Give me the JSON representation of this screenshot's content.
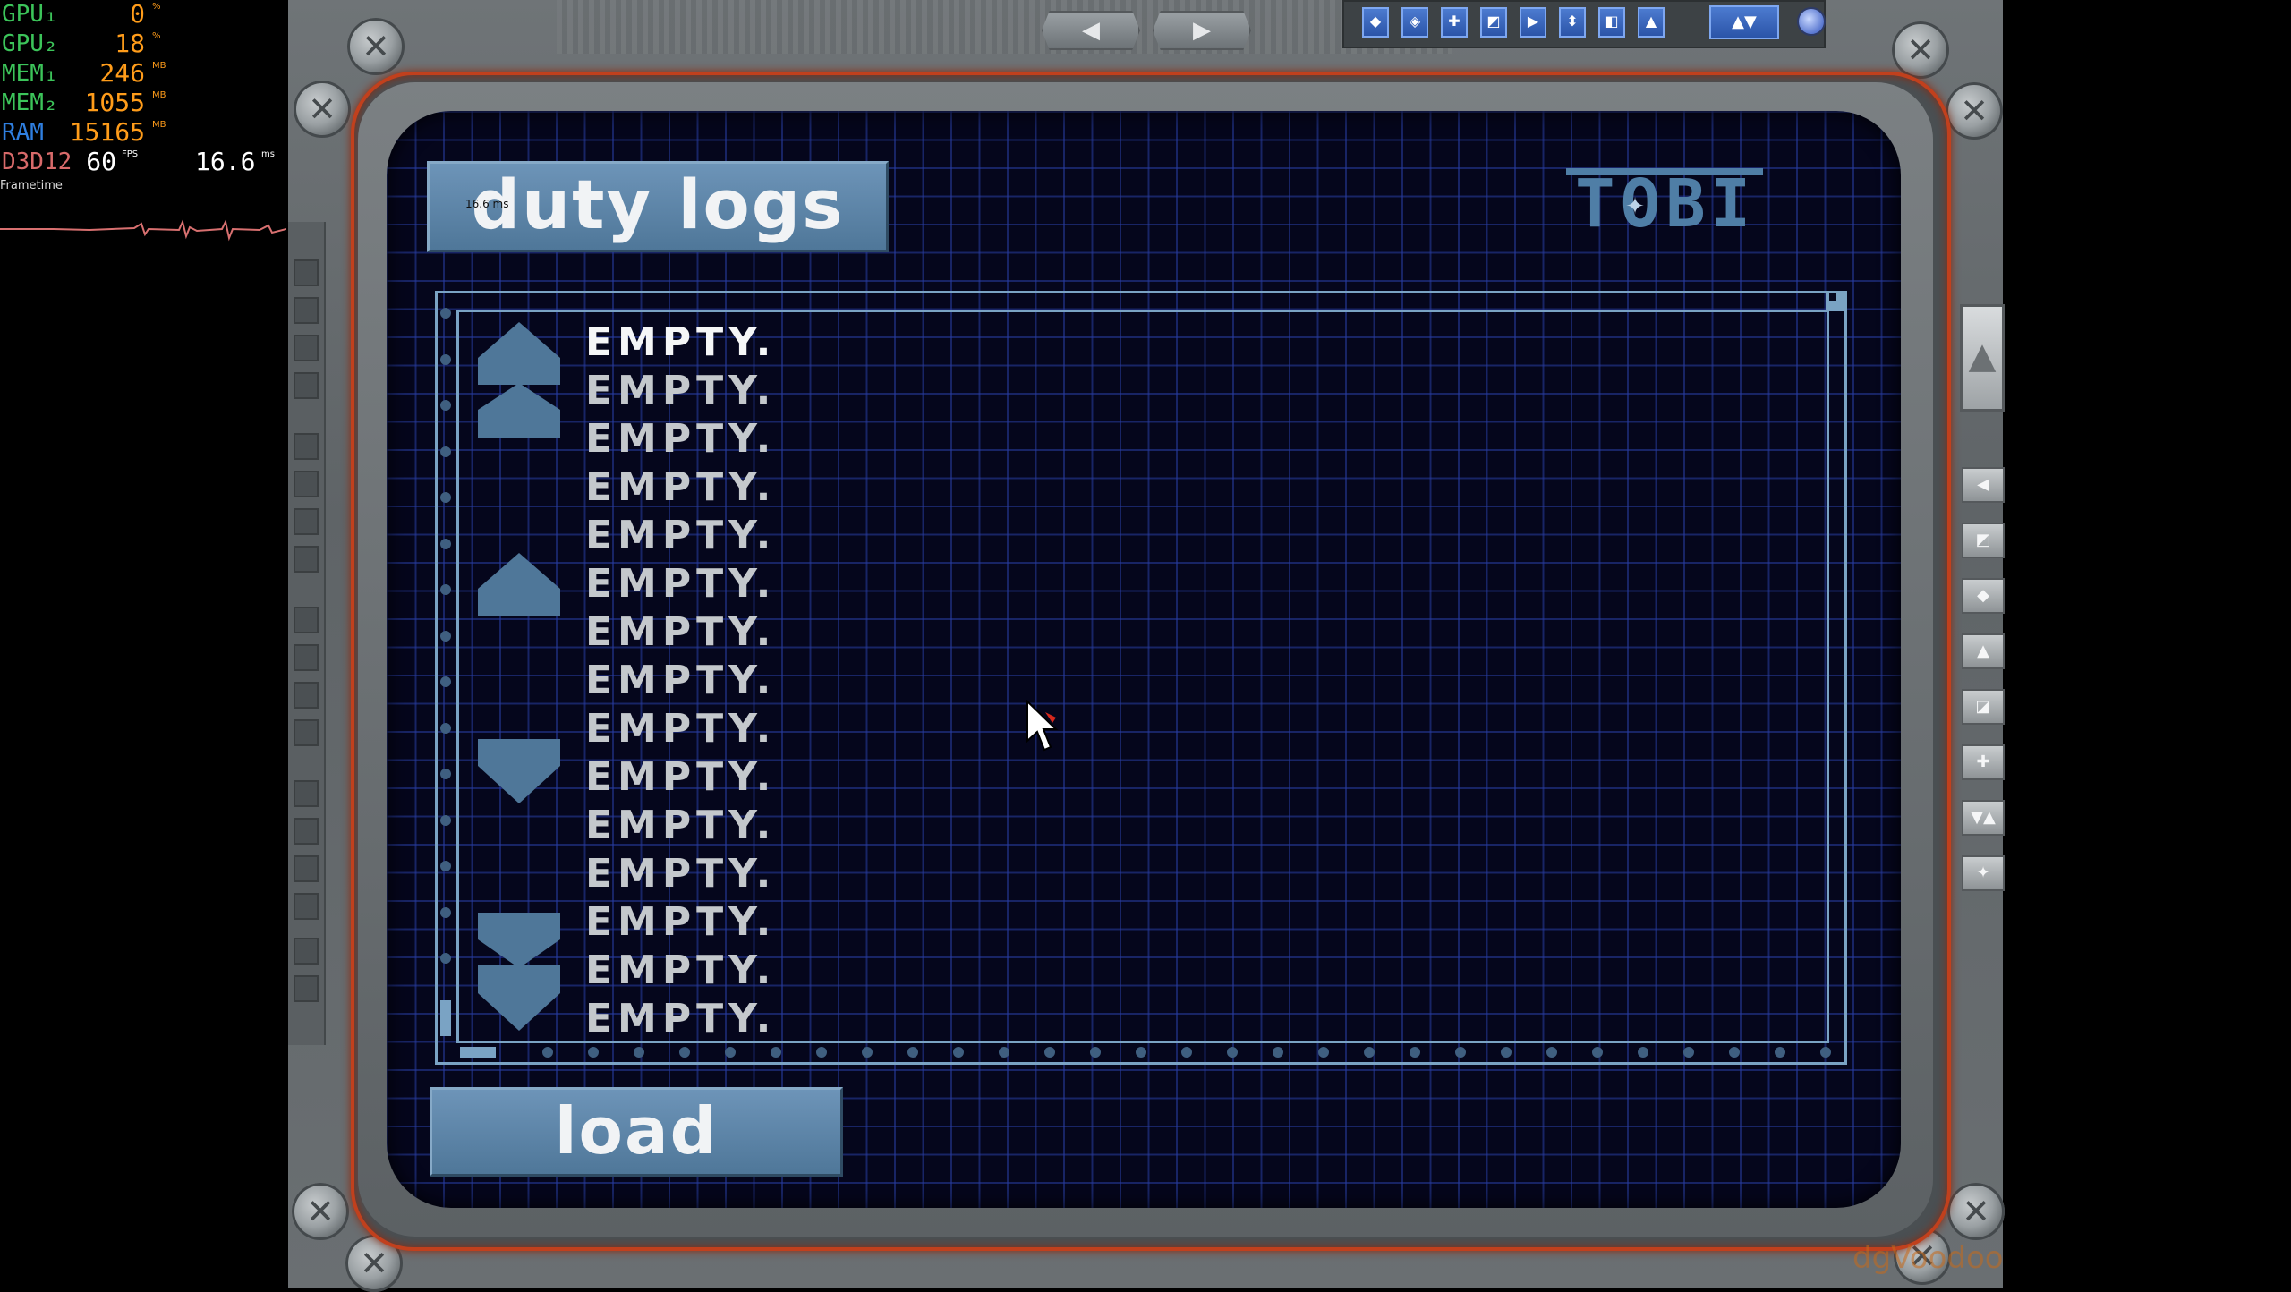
{
  "osd": {
    "rows": [
      {
        "label": "GPU₁",
        "value": "0",
        "unit": "%",
        "color": "#3cc45a"
      },
      {
        "label": "GPU₂",
        "value": "18",
        "unit": "%",
        "color": "#3cc45a"
      },
      {
        "label": "MEM₁",
        "value": "246",
        "unit": "MB",
        "color": "#3cc45a"
      },
      {
        "label": "MEM₂",
        "value": "1055",
        "unit": "MB",
        "color": "#3cc45a"
      },
      {
        "label": "RAM",
        "value": "15165",
        "unit": "MB",
        "color": "#2f7fe0"
      },
      {
        "label": "D3D12",
        "value": "60",
        "unit": "FPS",
        "color": "#d86a6a"
      }
    ],
    "frametime_value": "16.6",
    "frametime_unit": "ms",
    "frametime_label": "Frametime"
  },
  "title": {
    "label": "duty logs",
    "tiny_ms": "16.6 ms"
  },
  "logo": {
    "text": "TOBI"
  },
  "slots": [
    "EMPTY.",
    "EMPTY.",
    "EMPTY.",
    "EMPTY.",
    "EMPTY.",
    "EMPTY.",
    "EMPTY.",
    "EMPTY.",
    "EMPTY.",
    "EMPTY.",
    "EMPTY.",
    "EMPTY.",
    "EMPTY.",
    "EMPTY.",
    "EMPTY."
  ],
  "load": {
    "label": "load"
  },
  "nav": {
    "prev_glyph": "◀",
    "next_glyph": "▶"
  },
  "toolbar": {
    "icons": [
      "mission-icon",
      "map-icon",
      "target-icon",
      "squad-icon",
      "flag-icon",
      "unit-icon",
      "log-icon",
      "ship-icon"
    ],
    "glyphs": [
      "◆",
      "◈",
      "✚",
      "◩",
      "▶",
      "⬍",
      "◧",
      "▲"
    ],
    "wide_glyph": "▲▼",
    "globe_icon": "globe-icon"
  },
  "right_tools": {
    "top_glyph": "▲",
    "buttons": [
      "◀",
      "◩",
      "◆",
      "▲",
      "◪",
      "✚",
      "▼▲",
      "✦"
    ]
  },
  "colors": {
    "accent": "#5b84a9",
    "screen_bg": "#05061c",
    "grid": "#283ca0",
    "rim": "#c1401d",
    "text_empty": "#c4c8cc",
    "text_empty_first": "#f5f6f7"
  },
  "watermark": "dgVoodoo"
}
